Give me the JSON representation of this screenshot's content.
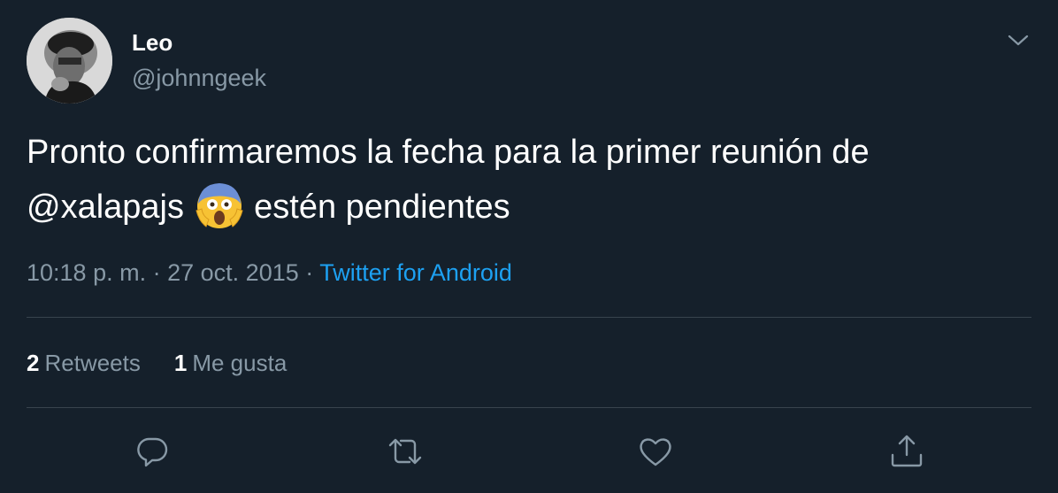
{
  "author": {
    "display_name": "Leo",
    "handle": "@johnngeek"
  },
  "tweet": {
    "text_before": "Pronto confirmaremos la fecha para la primer reunión de",
    "mention": "@xalapajs",
    "emoji": "face-screaming-in-fear",
    "text_after": "estén pendientes"
  },
  "meta": {
    "time": "10:18 p. m.",
    "separator1": "·",
    "date": "27 oct. 2015",
    "separator2": "·",
    "source": "Twitter for Android"
  },
  "stats": {
    "retweets_count": "2",
    "retweets_label": "Retweets",
    "likes_count": "1",
    "likes_label": "Me gusta"
  },
  "actions": {
    "reply_icon": "reply-icon",
    "retweet_icon": "retweet-icon",
    "like_icon": "heart-icon",
    "share_icon": "share-icon"
  },
  "colors": {
    "background": "#15202b",
    "primary_text": "#ffffff",
    "secondary_text": "#8899a6",
    "accent": "#1da1f2",
    "divider": "#38444d"
  }
}
